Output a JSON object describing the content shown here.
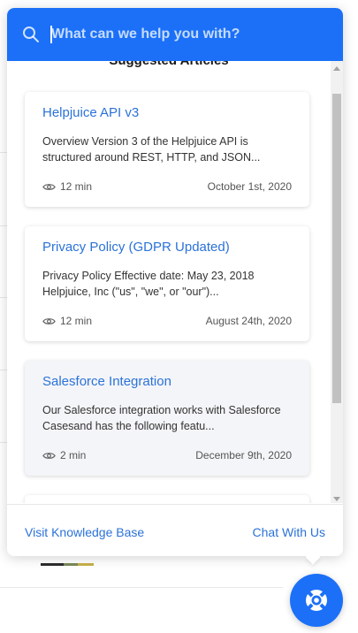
{
  "search": {
    "placeholder": "What can we help you with?"
  },
  "section_title": "Suggested Articles",
  "articles": [
    {
      "title": "Helpjuice API v3",
      "excerpt": "Overview Version 3 of the Helpjuice API is structured around REST, HTTP, and JSON...",
      "read_time": "12 min",
      "date": "October 1st, 2020"
    },
    {
      "title": "Privacy Policy (GDPR Updated)",
      "excerpt": "Privacy Policy Effective date: May 23, 2018 Helpjuice, Inc (\"us\", \"we\", or \"our\")...",
      "read_time": "12 min",
      "date": "August 24th, 2020"
    },
    {
      "title": "Salesforce Integration",
      "excerpt": "Our Salesforce integration works with Salesforce Casesand has the following featu...",
      "read_time": "2 min",
      "date": "December 9th, 2020"
    }
  ],
  "footer": {
    "visit_label": "Visit Knowledge Base",
    "chat_label": "Chat With Us"
  },
  "colors": {
    "accent": "#1b70f7",
    "link": "#2b72d8"
  },
  "icons": {
    "search": "search-icon",
    "eye": "eye-icon",
    "launcher": "lifebuoy-icon"
  }
}
